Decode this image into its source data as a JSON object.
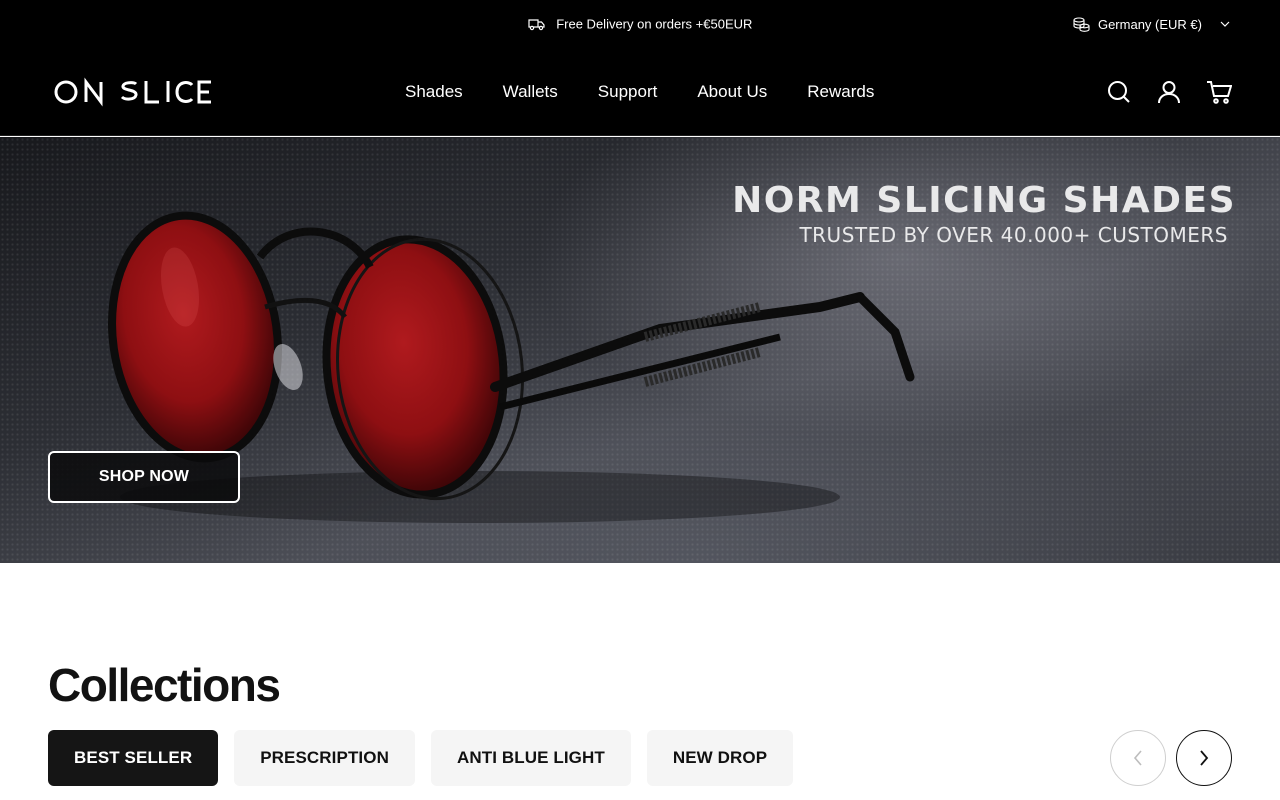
{
  "announcement": {
    "promo_text": "Free Delivery on orders +€50EUR",
    "country_selector": "Germany (EUR €)"
  },
  "header": {
    "logo_text": "ON SLICE",
    "nav": [
      "Shades",
      "Wallets",
      "Support",
      "About Us",
      "Rewards"
    ],
    "icons": [
      "search-icon",
      "account-icon",
      "cart-icon"
    ]
  },
  "hero": {
    "title": "NORM SLICING SHADES",
    "subtitle": "TRUSTED BY OVER 40.000+ CUSTOMERS",
    "cta_label": "SHOP NOW"
  },
  "collections": {
    "heading": "Collections",
    "tabs": [
      "BEST SELLER",
      "PRESCRIPTION",
      "ANTI BLUE LIGHT",
      "NEW DROP"
    ],
    "active_tab": "BEST SELLER"
  },
  "colors": {
    "header_bg": "#000000",
    "active_tab_bg": "#151515",
    "tab_bg": "#f5f5f5",
    "lens_red": "#8e0f12"
  }
}
